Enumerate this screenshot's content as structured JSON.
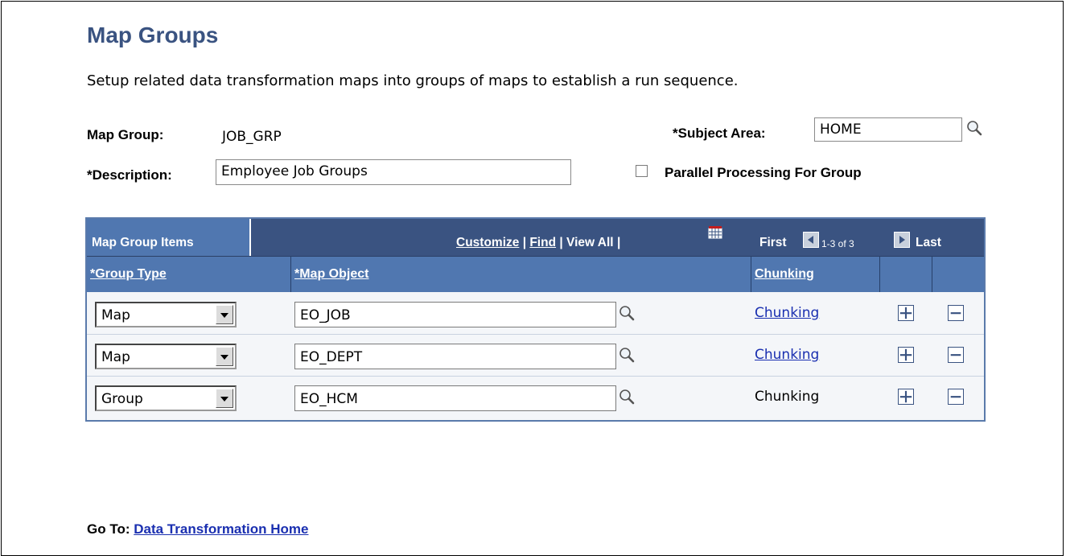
{
  "page": {
    "title": "Map Groups",
    "description": "Setup related data transformation maps into groups of maps to establish a run sequence."
  },
  "form": {
    "map_group_label": "Map Group:",
    "map_group_value": "JOB_GRP",
    "subject_area_label": "*Subject Area:",
    "subject_area_value": "HOME",
    "description_label": "*Description:",
    "description_value": "Employee Job Groups",
    "parallel_label": "Parallel Processing For Group",
    "parallel_checked": false
  },
  "grid": {
    "title": "Map Group Items",
    "customize": "Customize",
    "find": "Find",
    "view_all": "View All",
    "sep": "|",
    "first": "First",
    "range": "1-3 of 3",
    "last": "Last",
    "columns": {
      "group_type": "*Group Type",
      "map_object": "*Map Object",
      "chunking": "Chunking"
    },
    "rows": [
      {
        "group_type": "Map",
        "map_object": "EO_JOB",
        "chunking": "Chunking",
        "chunking_link": true
      },
      {
        "group_type": "Map",
        "map_object": "EO_DEPT",
        "chunking": "Chunking",
        "chunking_link": true
      },
      {
        "group_type": "Group",
        "map_object": "EO_HCM",
        "chunking": "Chunking",
        "chunking_link": false
      }
    ]
  },
  "footer": {
    "goto_label": "Go To:",
    "goto_link": "Data Transformation Home"
  },
  "colors": {
    "title": "#3a5381",
    "grid_header": "#5077b0",
    "grid_nav": "#3a5381",
    "link": "#1a2fb0"
  }
}
